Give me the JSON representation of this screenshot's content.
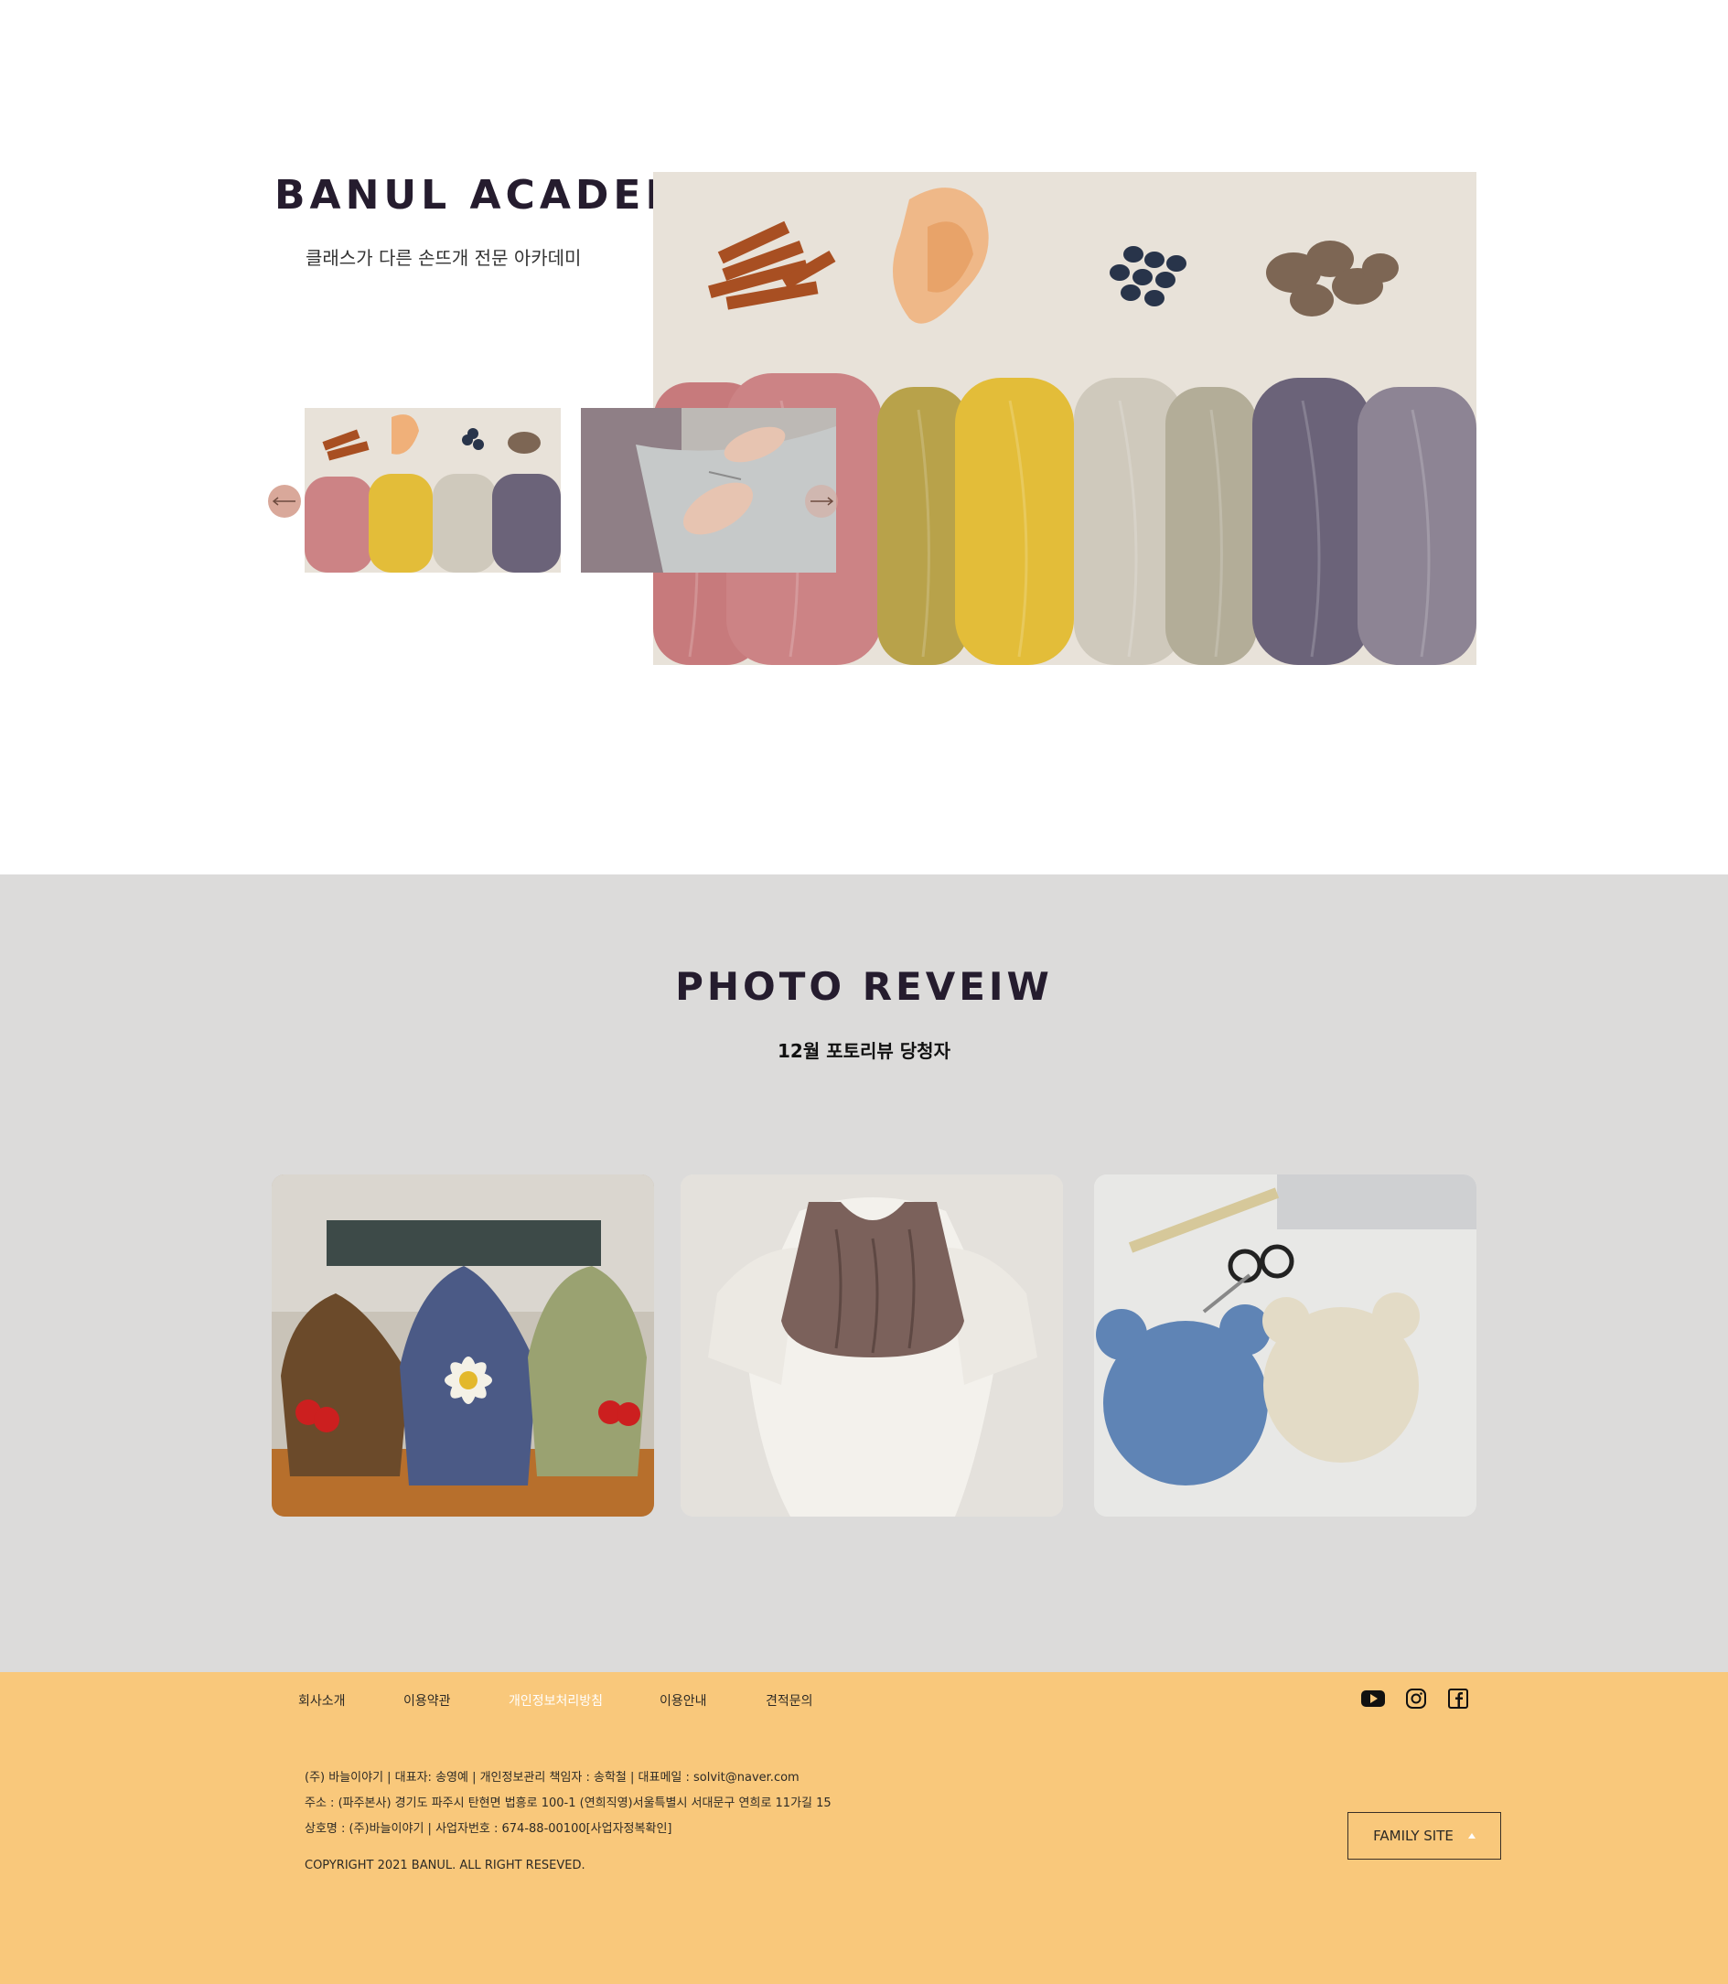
{
  "hero": {
    "title": "BANUL ACADEMY",
    "subtitle": "클래스가 다른 손뜨개 전문 아카데미"
  },
  "review": {
    "title": "PHOTO REVEIW",
    "subtitle": "12월 포토리뷰 당청자"
  },
  "footer": {
    "nav": [
      "회사소개",
      "이용약관",
      "개인정보처리방침",
      "이용안내",
      "견적문의"
    ],
    "social_icons": [
      "youtube-icon",
      "instagram-icon",
      "facebook-icon"
    ],
    "info": [
      "(주) 바늘이야기 | 대표자: 송영예 | 개인정보관리 책임자 : 송학철 | 대표메일 : solvit@naver.com",
      "주소 : (파주본사) 경기도 파주시 탄현면 법흥로 100-1 (연희직영)서울특별시 서대문구 연희로 11가길 15",
      "상호명 : (주)바늘이야기 | 사업자번호 : 674-88-00100[사업자정복확인]"
    ],
    "copyright": "COPYRIGHT 2021 BANUL. ALL RIGHT RESEVED.",
    "family_site_label": "FAMILY SITE"
  },
  "colors": {
    "footer_bg": "#f9c87b",
    "review_bg": "#dcdbda",
    "title": "#251c2e",
    "active_nav": "#ffffff"
  }
}
